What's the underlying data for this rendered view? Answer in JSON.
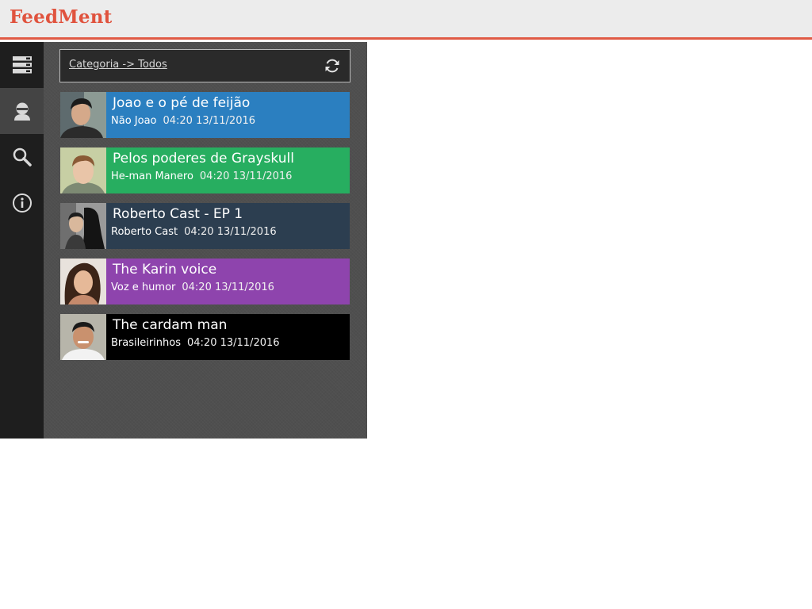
{
  "app": {
    "brand": "FeedMent",
    "accent_color": "#e05a45"
  },
  "sidebar": {
    "items": [
      {
        "name": "list",
        "icon": "list-icon",
        "active": false
      },
      {
        "name": "profile",
        "icon": "user-icon",
        "active": true
      },
      {
        "name": "search",
        "icon": "search-icon",
        "active": false
      },
      {
        "name": "info",
        "icon": "info-icon",
        "active": false
      }
    ]
  },
  "category_bar": {
    "label": "Categoria -> Todos",
    "refresh_icon": "refresh-icon"
  },
  "feeds": [
    {
      "title": "Joao e o pé de feijão",
      "author": "Não Joao",
      "time": "04:20 13/11/2016",
      "color": "#2b7fc0"
    },
    {
      "title": "Pelos poderes de Grayskull",
      "author": "He-man Manero",
      "time": "04:20 13/11/2016",
      "color": "#27ae60"
    },
    {
      "title": "Roberto Cast - EP 1",
      "author": "Roberto Cast",
      "time": "04:20 13/11/2016",
      "color": "#2c3e50"
    },
    {
      "title": "The Karin voice",
      "author": "Voz e humor",
      "time": "04:20 13/11/2016",
      "color": "#8e44ad"
    },
    {
      "title": "The cardam man",
      "author": "Brasileirinhos",
      "time": "04:20 13/11/2016",
      "color": "#000000"
    }
  ]
}
